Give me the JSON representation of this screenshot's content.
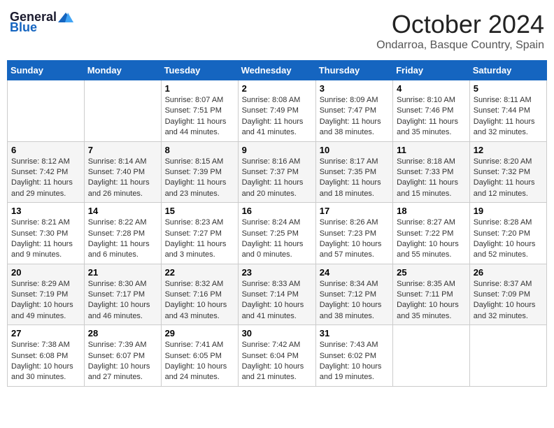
{
  "header": {
    "logo_general": "General",
    "logo_blue": "Blue",
    "month": "October 2024",
    "location": "Ondarroa, Basque Country, Spain"
  },
  "weekdays": [
    "Sunday",
    "Monday",
    "Tuesday",
    "Wednesday",
    "Thursday",
    "Friday",
    "Saturday"
  ],
  "weeks": [
    [
      {
        "day": null,
        "sunrise": null,
        "sunset": null,
        "daylight": null
      },
      {
        "day": null,
        "sunrise": null,
        "sunset": null,
        "daylight": null
      },
      {
        "day": "1",
        "sunrise": "Sunrise: 8:07 AM",
        "sunset": "Sunset: 7:51 PM",
        "daylight": "Daylight: 11 hours and 44 minutes."
      },
      {
        "day": "2",
        "sunrise": "Sunrise: 8:08 AM",
        "sunset": "Sunset: 7:49 PM",
        "daylight": "Daylight: 11 hours and 41 minutes."
      },
      {
        "day": "3",
        "sunrise": "Sunrise: 8:09 AM",
        "sunset": "Sunset: 7:47 PM",
        "daylight": "Daylight: 11 hours and 38 minutes."
      },
      {
        "day": "4",
        "sunrise": "Sunrise: 8:10 AM",
        "sunset": "Sunset: 7:46 PM",
        "daylight": "Daylight: 11 hours and 35 minutes."
      },
      {
        "day": "5",
        "sunrise": "Sunrise: 8:11 AM",
        "sunset": "Sunset: 7:44 PM",
        "daylight": "Daylight: 11 hours and 32 minutes."
      }
    ],
    [
      {
        "day": "6",
        "sunrise": "Sunrise: 8:12 AM",
        "sunset": "Sunset: 7:42 PM",
        "daylight": "Daylight: 11 hours and 29 minutes."
      },
      {
        "day": "7",
        "sunrise": "Sunrise: 8:14 AM",
        "sunset": "Sunset: 7:40 PM",
        "daylight": "Daylight: 11 hours and 26 minutes."
      },
      {
        "day": "8",
        "sunrise": "Sunrise: 8:15 AM",
        "sunset": "Sunset: 7:39 PM",
        "daylight": "Daylight: 11 hours and 23 minutes."
      },
      {
        "day": "9",
        "sunrise": "Sunrise: 8:16 AM",
        "sunset": "Sunset: 7:37 PM",
        "daylight": "Daylight: 11 hours and 20 minutes."
      },
      {
        "day": "10",
        "sunrise": "Sunrise: 8:17 AM",
        "sunset": "Sunset: 7:35 PM",
        "daylight": "Daylight: 11 hours and 18 minutes."
      },
      {
        "day": "11",
        "sunrise": "Sunrise: 8:18 AM",
        "sunset": "Sunset: 7:33 PM",
        "daylight": "Daylight: 11 hours and 15 minutes."
      },
      {
        "day": "12",
        "sunrise": "Sunrise: 8:20 AM",
        "sunset": "Sunset: 7:32 PM",
        "daylight": "Daylight: 11 hours and 12 minutes."
      }
    ],
    [
      {
        "day": "13",
        "sunrise": "Sunrise: 8:21 AM",
        "sunset": "Sunset: 7:30 PM",
        "daylight": "Daylight: 11 hours and 9 minutes."
      },
      {
        "day": "14",
        "sunrise": "Sunrise: 8:22 AM",
        "sunset": "Sunset: 7:28 PM",
        "daylight": "Daylight: 11 hours and 6 minutes."
      },
      {
        "day": "15",
        "sunrise": "Sunrise: 8:23 AM",
        "sunset": "Sunset: 7:27 PM",
        "daylight": "Daylight: 11 hours and 3 minutes."
      },
      {
        "day": "16",
        "sunrise": "Sunrise: 8:24 AM",
        "sunset": "Sunset: 7:25 PM",
        "daylight": "Daylight: 11 hours and 0 minutes."
      },
      {
        "day": "17",
        "sunrise": "Sunrise: 8:26 AM",
        "sunset": "Sunset: 7:23 PM",
        "daylight": "Daylight: 10 hours and 57 minutes."
      },
      {
        "day": "18",
        "sunrise": "Sunrise: 8:27 AM",
        "sunset": "Sunset: 7:22 PM",
        "daylight": "Daylight: 10 hours and 55 minutes."
      },
      {
        "day": "19",
        "sunrise": "Sunrise: 8:28 AM",
        "sunset": "Sunset: 7:20 PM",
        "daylight": "Daylight: 10 hours and 52 minutes."
      }
    ],
    [
      {
        "day": "20",
        "sunrise": "Sunrise: 8:29 AM",
        "sunset": "Sunset: 7:19 PM",
        "daylight": "Daylight: 10 hours and 49 minutes."
      },
      {
        "day": "21",
        "sunrise": "Sunrise: 8:30 AM",
        "sunset": "Sunset: 7:17 PM",
        "daylight": "Daylight: 10 hours and 46 minutes."
      },
      {
        "day": "22",
        "sunrise": "Sunrise: 8:32 AM",
        "sunset": "Sunset: 7:16 PM",
        "daylight": "Daylight: 10 hours and 43 minutes."
      },
      {
        "day": "23",
        "sunrise": "Sunrise: 8:33 AM",
        "sunset": "Sunset: 7:14 PM",
        "daylight": "Daylight: 10 hours and 41 minutes."
      },
      {
        "day": "24",
        "sunrise": "Sunrise: 8:34 AM",
        "sunset": "Sunset: 7:12 PM",
        "daylight": "Daylight: 10 hours and 38 minutes."
      },
      {
        "day": "25",
        "sunrise": "Sunrise: 8:35 AM",
        "sunset": "Sunset: 7:11 PM",
        "daylight": "Daylight: 10 hours and 35 minutes."
      },
      {
        "day": "26",
        "sunrise": "Sunrise: 8:37 AM",
        "sunset": "Sunset: 7:09 PM",
        "daylight": "Daylight: 10 hours and 32 minutes."
      }
    ],
    [
      {
        "day": "27",
        "sunrise": "Sunrise: 7:38 AM",
        "sunset": "Sunset: 6:08 PM",
        "daylight": "Daylight: 10 hours and 30 minutes."
      },
      {
        "day": "28",
        "sunrise": "Sunrise: 7:39 AM",
        "sunset": "Sunset: 6:07 PM",
        "daylight": "Daylight: 10 hours and 27 minutes."
      },
      {
        "day": "29",
        "sunrise": "Sunrise: 7:41 AM",
        "sunset": "Sunset: 6:05 PM",
        "daylight": "Daylight: 10 hours and 24 minutes."
      },
      {
        "day": "30",
        "sunrise": "Sunrise: 7:42 AM",
        "sunset": "Sunset: 6:04 PM",
        "daylight": "Daylight: 10 hours and 21 minutes."
      },
      {
        "day": "31",
        "sunrise": "Sunrise: 7:43 AM",
        "sunset": "Sunset: 6:02 PM",
        "daylight": "Daylight: 10 hours and 19 minutes."
      },
      {
        "day": null,
        "sunrise": null,
        "sunset": null,
        "daylight": null
      },
      {
        "day": null,
        "sunrise": null,
        "sunset": null,
        "daylight": null
      }
    ]
  ]
}
